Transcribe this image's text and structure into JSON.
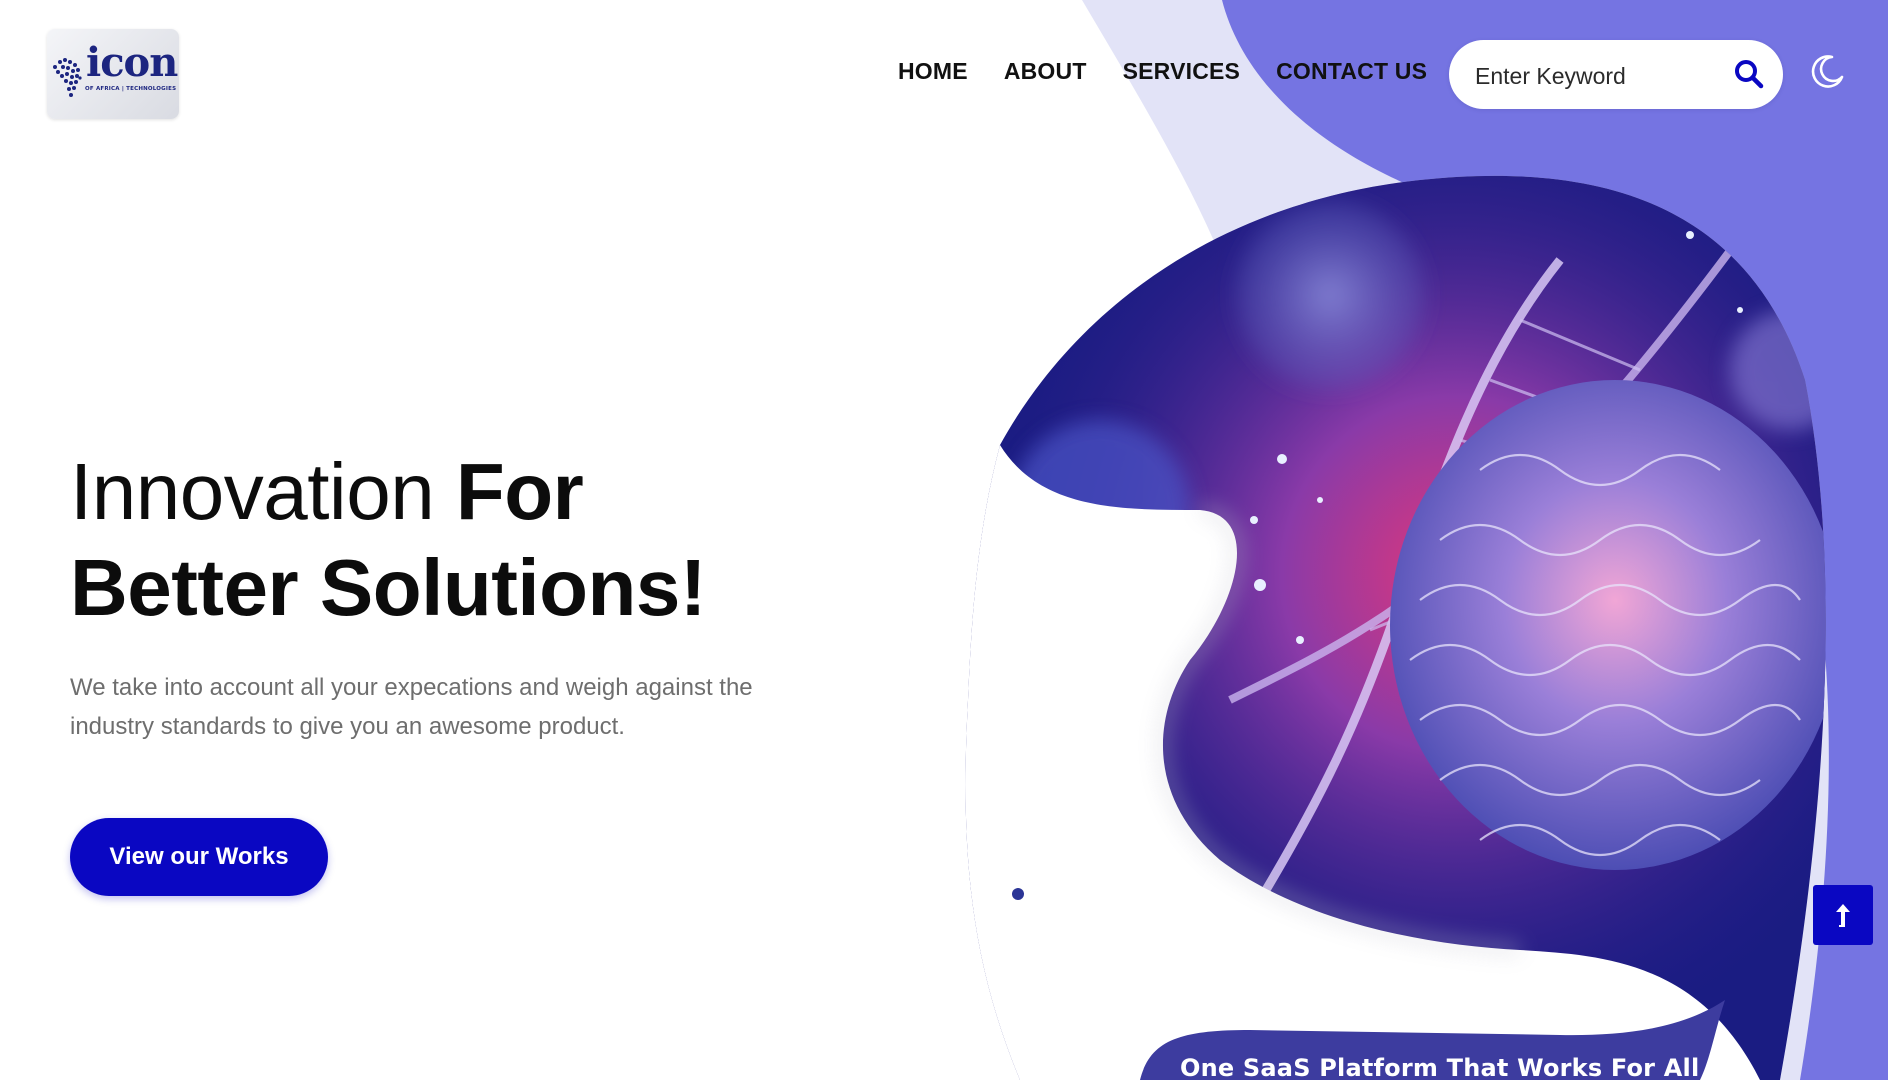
{
  "logo": {
    "word": "icon",
    "tagline": "OF AFRICA | TECHNOLOGIES"
  },
  "nav": {
    "items": [
      "HOME",
      "ABOUT",
      "SERVICES",
      "CONTACT US"
    ]
  },
  "search": {
    "placeholder": "Enter Keyword",
    "value": ""
  },
  "icons": {
    "search": "search-icon",
    "theme": "moon-icon",
    "scroll_top": "arrow-up-icon"
  },
  "hero": {
    "title_light": "Innovation",
    "title_bold_1": "For",
    "title_bold_2": "Better Solutions!",
    "description": "We take into account all your expecations and weigh against the industry standards to give you an awesome product.",
    "cta_label": "View our Works"
  },
  "hero_banner": {
    "caption": "One SaaS Platform That Works For All"
  },
  "colors": {
    "accent": "#0a07c2",
    "lavender_light": "#e2e3f7",
    "purple_wave": "#7574e2",
    "image_navy": "#1a1c82",
    "banner": "#3d3c9f"
  }
}
